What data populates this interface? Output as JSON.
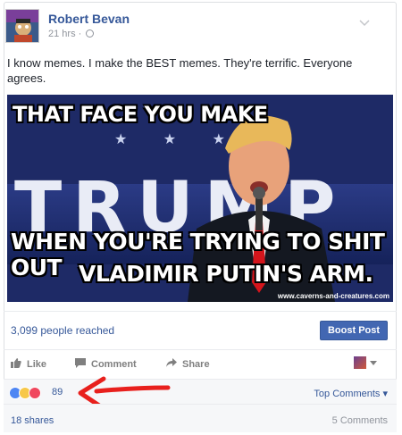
{
  "post": {
    "author": "Robert Bevan",
    "time": "21 hrs ·",
    "text": "I know memes. I make the BEST memes. They're terrific. Everyone agrees."
  },
  "meme": {
    "top_caption": "THAT FACE YOU MAKE",
    "bottom_caption_line1": "WHEN YOU'RE TRYING TO SHIT OUT",
    "bottom_caption_line2": "VLADIMIR PUTIN'S ARM.",
    "background_letters": "TRUMP",
    "watermark": "www.caverns-and-creatures.com"
  },
  "insights": {
    "reach": "3,099 people reached",
    "boost_label": "Boost Post"
  },
  "actions": {
    "like": "Like",
    "comment": "Comment",
    "share": "Share"
  },
  "reactions": {
    "count": "89",
    "top_comments": "Top Comments"
  },
  "footer": {
    "shares": "18 shares",
    "comments": "5 Comments"
  },
  "colors": {
    "link": "#365899",
    "boost": "#4267b2",
    "arrow": "#e8201d"
  }
}
